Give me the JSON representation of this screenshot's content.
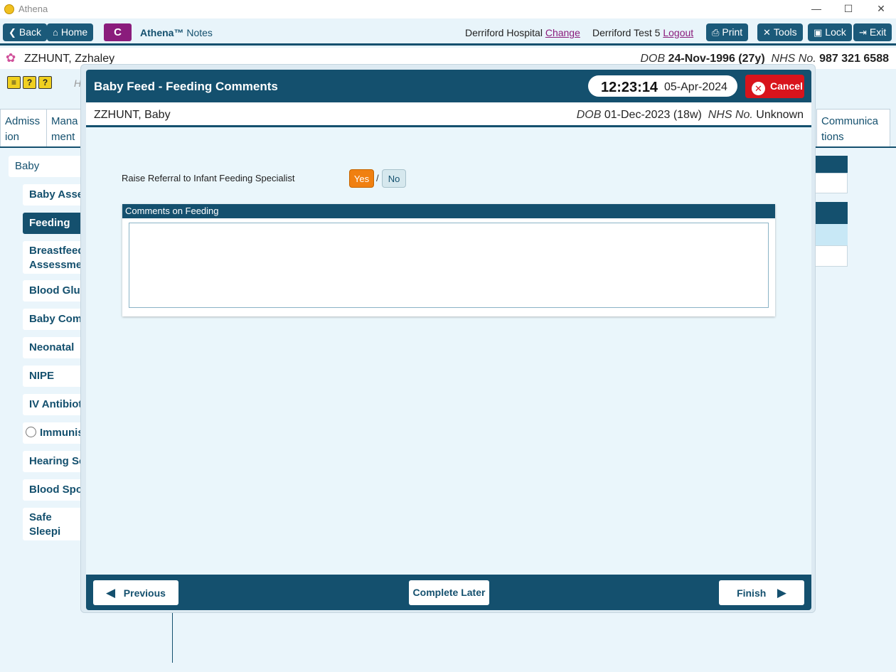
{
  "window": {
    "title": "Athena",
    "minimize": "—",
    "maximize": "☐",
    "close": "✕"
  },
  "toolbar": {
    "back": "Back",
    "home": "Home",
    "c_button": "C",
    "brand_name": "Athena™",
    "brand_suffix": "Notes",
    "hospital": "Derriford Hospital",
    "change": "Change",
    "user": "Derriford Test 5",
    "logout": "Logout",
    "print": "Print",
    "tools": "Tools",
    "lock": "Lock",
    "exit": "Exit"
  },
  "patient": {
    "name": "ZZHUNT, Zzhaley",
    "dob_label": "DOB",
    "dob": "24-Nov-1996 (27y)",
    "nhs_label": "NHS No.",
    "nhs": "987 321 6588"
  },
  "background": {
    "h_fragment": "H",
    "tabs": [
      "Admiss ion",
      "Mana ment",
      "Communica tions"
    ],
    "nav": {
      "baby": "Baby",
      "items": [
        "Baby Assess",
        "Feeding",
        "Breastfeedi Assessment",
        "Blood Gluc",
        "Baby Comm",
        "Neonatal",
        "NIPE",
        "IV Antibioti",
        "Immunis",
        "Hearing Sc",
        "Blood Spot",
        "Safe Sleepi Assessment"
      ]
    }
  },
  "modal": {
    "title": "Baby Feed - Feeding Comments",
    "time": "12:23:14",
    "date": "05-Apr-2024",
    "cancel": "Cancel",
    "baby_name": "ZZHUNT, Baby",
    "dob_label": "DOB",
    "baby_dob": "01-Dec-2023 (18w)",
    "nhs_label": "NHS No.",
    "baby_nhs": "Unknown",
    "question": "Raise Referral to Infant Feeding Specialist",
    "yes": "Yes",
    "slash": "/",
    "no": "No",
    "comments_header": "Comments on Feeding",
    "comments_value": "",
    "previous": "Previous",
    "complete_later": "Complete Later",
    "finish": "Finish"
  },
  "colors": {
    "primary": "#14506e",
    "accent_purple": "#8a1c7c",
    "cancel_red": "#d8141c",
    "yes_orange": "#f08010"
  }
}
